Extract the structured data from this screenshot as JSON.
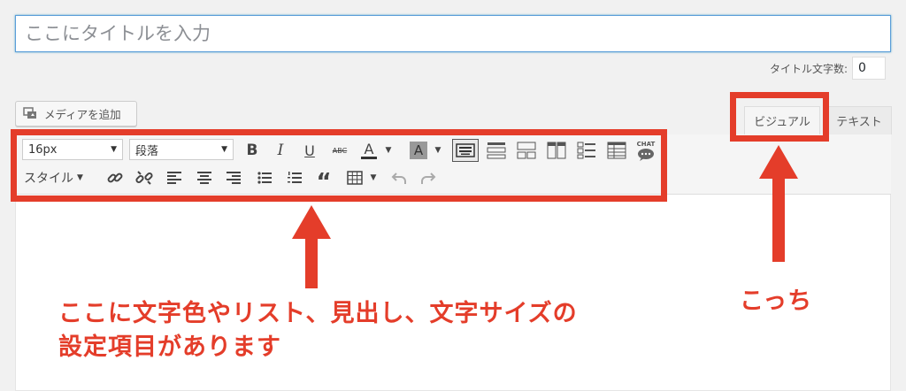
{
  "title_field": {
    "placeholder": "ここにタイトルを入力"
  },
  "char_count": {
    "label": "タイトル文字数:",
    "value": "0"
  },
  "media_button": {
    "label": "メディアを追加"
  },
  "tabs": {
    "visual": "ビジュアル",
    "text": "テキスト"
  },
  "toolbar": {
    "font_size": "16px",
    "format": "段落",
    "style": "スタイル",
    "chat_icon_label": "CHAT"
  },
  "annotations": {
    "left_line1": "ここに文字色やリスト、見出し、文字サイズの",
    "left_line2": "設定項目があります",
    "right": "こっち"
  },
  "colors": {
    "annotation": "#e43d2a",
    "focus": "#5b9dd9"
  }
}
